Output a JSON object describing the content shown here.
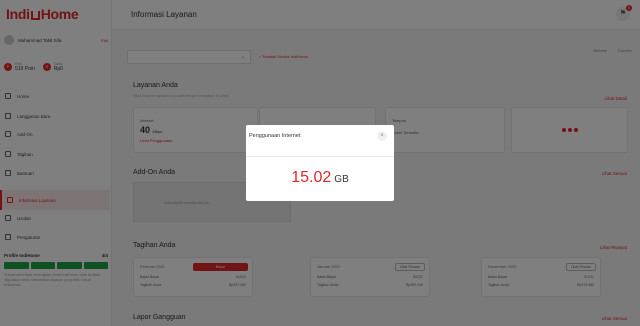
{
  "brand": {
    "name_part1": "Indi",
    "name_part2": "Home",
    "color": "#e4262c"
  },
  "profile": {
    "name": "Muhammad Tabit Sifa",
    "edit_label": "Edit"
  },
  "points": [
    {
      "label": "Poin",
      "value": "519 Poin"
    },
    {
      "label": "Saldo",
      "value": "Rp0"
    }
  ],
  "nav": [
    {
      "label": "Home",
      "icon": "home-icon"
    },
    {
      "label": "Langganan Baru",
      "icon": "cart-icon"
    },
    {
      "label": "Add-On",
      "icon": "addon-icon"
    },
    {
      "label": "Tagihan",
      "icon": "bill-icon"
    },
    {
      "label": "Bantuan",
      "icon": "help-icon"
    },
    {
      "label": "Informasi Layanan",
      "icon": "info-icon"
    },
    {
      "label": "Usulan",
      "icon": "suggestion-icon"
    },
    {
      "label": "Pengaturan",
      "icon": "gear-icon"
    }
  ],
  "prefill": {
    "title": "Profile IndiHome",
    "count": "4/4",
    "note": "Terima kasih telah melengkapi profile IndiHome. Data ini akan digunakan untuk memberikan layanan yang lebih sesuai kebutuhan."
  },
  "header": {
    "title": "Informasi Layanan",
    "notification_count": "8"
  },
  "main": {
    "add_service_link": "+ Tambah Nomor IndiHome",
    "top_actions": [
      "Refresh",
      "Transfer"
    ],
    "layanan": {
      "title": "Layanan Anda",
      "subtitle": "Pada bulan ini layanan anda aktif dengan kecepatan 40 Mbps",
      "link": "Lihat Detail",
      "internet_label": "Internet",
      "internet_speed": "40",
      "internet_unit": "Mbps",
      "internet_link": "Lihat Penggunaan",
      "phone_label": "Telepon",
      "phone_sub": "Paket Tersedia"
    },
    "addon": {
      "title": "Add-On Anda",
      "link": "Lihat Semua",
      "empty_text": "Anda belum memiliki Add-On"
    },
    "tagihan": {
      "title": "Tagihan Anda",
      "link": "Lihat Riwayat",
      "bills": [
        {
          "month": "Februari 2021",
          "button": "Bayar",
          "due_label": "Batas Bayar",
          "due_value": "5/4/21",
          "amount_label": "Tagihan Anda",
          "amount_value": "Rp357.360"
        },
        {
          "month": "Januari 2021",
          "button": "Lihat Rincian",
          "due_label": "Batas Bayar",
          "due_value": "5/2/21",
          "amount_label": "Tagihan Anda",
          "amount_value": "Rp392.410"
        },
        {
          "month": "Desember 2020",
          "button": "Lihat Rincian",
          "due_label": "Batas Bayar",
          "due_value": "5/1/21",
          "amount_label": "Tagihan Anda",
          "amount_value": "Rp373.980"
        }
      ]
    },
    "gangguan": {
      "title": "Lapor Gangguan",
      "link": "Lihat Semua"
    }
  },
  "modal": {
    "title": "Penggunaan Internet",
    "close_icon": "close-icon",
    "value": "15.02",
    "unit": "GB"
  }
}
